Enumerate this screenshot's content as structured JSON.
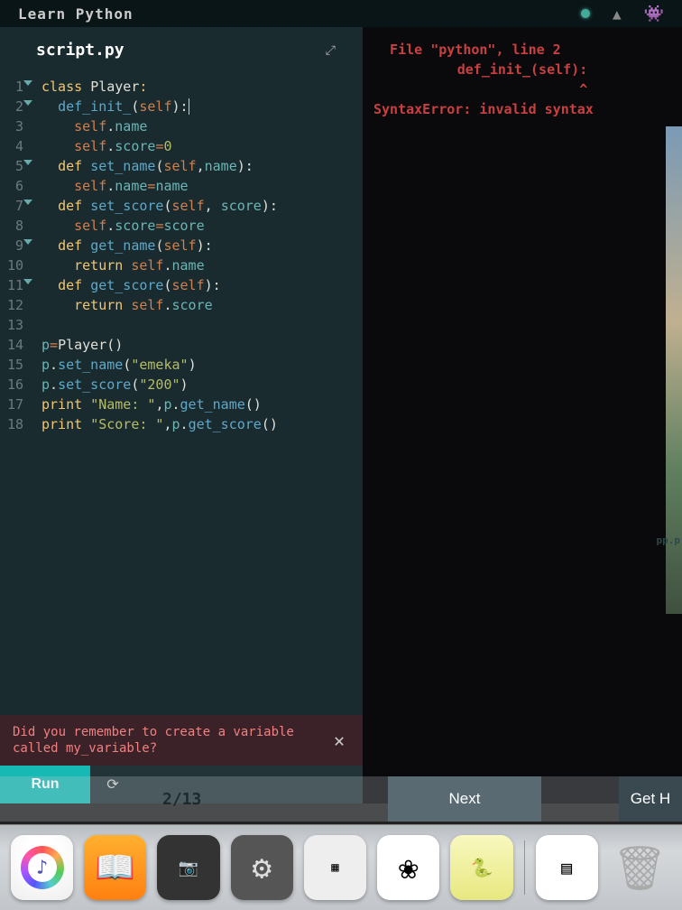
{
  "topbar": {
    "title": "Learn Python"
  },
  "editor": {
    "filename": "script.py",
    "lines": [
      {
        "n": 1,
        "fold": true,
        "html": "<span class='kw'>class</span> <span class='plain'>Player</span><span class='kw'>:</span>"
      },
      {
        "n": 2,
        "fold": true,
        "html": "  <span class='def'>def_init_</span><span class='plain'>(</span><span class='self'>self</span><span class='plain'>):</span><span class='cursor'></span>"
      },
      {
        "n": 3,
        "fold": false,
        "html": "    <span class='self'>self</span><span class='plain'>.</span><span class='attr'>name</span>"
      },
      {
        "n": 4,
        "fold": false,
        "html": "    <span class='self'>self</span><span class='plain'>.</span><span class='attr'>score</span><span class='op'>=</span><span class='num'>0</span>"
      },
      {
        "n": 5,
        "fold": true,
        "html": "  <span class='kw'>def</span> <span class='def'>set_name</span><span class='plain'>(</span><span class='self'>self</span><span class='plain'>,</span><span class='attr'>name</span><span class='plain'>):</span>"
      },
      {
        "n": 6,
        "fold": false,
        "html": "    <span class='self'>self</span><span class='plain'>.</span><span class='attr'>name</span><span class='op'>=</span><span class='attr'>name</span>"
      },
      {
        "n": 7,
        "fold": true,
        "html": "  <span class='kw'>def</span> <span class='def'>set_score</span><span class='plain'>(</span><span class='self'>self</span><span class='plain'>, </span><span class='attr'>score</span><span class='plain'>):</span>"
      },
      {
        "n": 8,
        "fold": false,
        "html": "    <span class='self'>self</span><span class='plain'>.</span><span class='attr'>score</span><span class='op'>=</span><span class='attr'>score</span>"
      },
      {
        "n": 9,
        "fold": true,
        "html": "  <span class='kw'>def</span> <span class='def'>get_name</span><span class='plain'>(</span><span class='self'>self</span><span class='plain'>):</span>"
      },
      {
        "n": 10,
        "fold": false,
        "html": "    <span class='kw'>return</span> <span class='self'>self</span><span class='plain'>.</span><span class='attr'>name</span>"
      },
      {
        "n": 11,
        "fold": true,
        "html": "  <span class='kw'>def</span> <span class='def'>get_score</span><span class='plain'>(</span><span class='self'>self</span><span class='plain'>):</span>"
      },
      {
        "n": 12,
        "fold": false,
        "html": "    <span class='kw'>return</span> <span class='self'>self</span><span class='plain'>.</span><span class='attr'>score</span>"
      },
      {
        "n": 13,
        "fold": false,
        "html": ""
      },
      {
        "n": 14,
        "fold": false,
        "html": "<span class='attr'>p</span><span class='op'>=</span><span class='plain'>Player()</span>"
      },
      {
        "n": 15,
        "fold": false,
        "html": "<span class='attr'>p</span><span class='plain'>.</span><span class='def'>set_name</span><span class='plain'>(</span><span class='str'>\"emeka\"</span><span class='plain'>)</span>"
      },
      {
        "n": 16,
        "fold": false,
        "html": "<span class='attr'>p</span><span class='plain'>.</span><span class='def'>set_score</span><span class='plain'>(</span><span class='str'>\"200\"</span><span class='plain'>)</span>"
      },
      {
        "n": 17,
        "fold": false,
        "html": "<span class='kw'>print</span> <span class='str'>\"Name: \"</span><span class='plain'>,</span><span class='attr'>p</span><span class='plain'>.</span><span class='def'>get_name</span><span class='plain'>()</span>"
      },
      {
        "n": 18,
        "fold": false,
        "html": "<span class='kw'>print</span> <span class='str'>\"Score: \"</span><span class='plain'>,</span><span class='attr'>p</span><span class='plain'>.</span><span class='def'>get_score</span><span class='plain'>()</span>"
      }
    ]
  },
  "hint": {
    "text": "Did you remember to create a variable called my_variable?",
    "close": "✕"
  },
  "actions": {
    "run": "Run",
    "reset": "⟳"
  },
  "console": {
    "l1": "  File \"python\", line 2",
    "l2": "def_init_(self):",
    "l3": "               ^",
    "l4": "SyntaxError: invalid syntax"
  },
  "footer": {
    "progress": "2/13",
    "next": "Next",
    "geth": "Get H"
  },
  "desktop_label": "pp.p"
}
